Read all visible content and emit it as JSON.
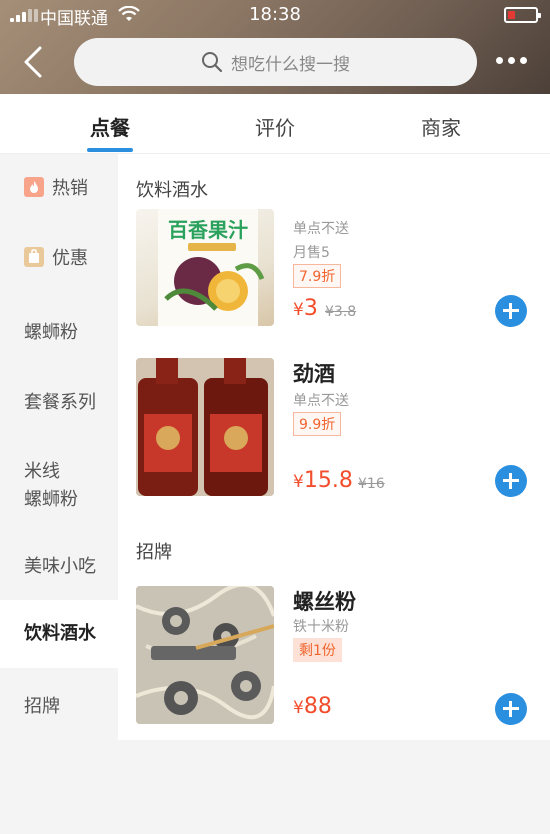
{
  "status_bar": {
    "carrier": "中国联通",
    "time": "18:38"
  },
  "header": {
    "search_placeholder": "想吃什么搜一搜"
  },
  "tabs": [
    {
      "label": "点餐"
    },
    {
      "label": "评价"
    },
    {
      "label": "商家"
    }
  ],
  "sidebar": {
    "items": [
      {
        "label": "热销"
      },
      {
        "label": "优惠"
      },
      {
        "label": "螺蛳粉"
      },
      {
        "label": "套餐系列"
      },
      {
        "label": "米线\n螺蛳粉"
      },
      {
        "label": "美味小吃"
      },
      {
        "label": "饮料酒水"
      },
      {
        "label": "招牌"
      }
    ]
  },
  "sections": [
    {
      "title": "饮料酒水",
      "products": [
        {
          "note": "单点不送",
          "sales": "月售5",
          "tag": "7.9折",
          "currency": "¥",
          "price": "3",
          "old_price": "¥3.8",
          "image_label": "百香果汁"
        },
        {
          "name": "劲酒",
          "note": "单点不送",
          "tag": "9.9折",
          "currency": "¥",
          "price": "15.8",
          "old_price": "¥16"
        }
      ]
    },
    {
      "title": "招牌",
      "products": [
        {
          "name": "螺丝粉",
          "description": "铁十米粉",
          "tag": "剩1份",
          "currency": "¥",
          "price": "88"
        }
      ]
    }
  ],
  "colors": {
    "accent": "#2b8fe0",
    "price": "#f24d2c",
    "tag": "#f0652f"
  }
}
